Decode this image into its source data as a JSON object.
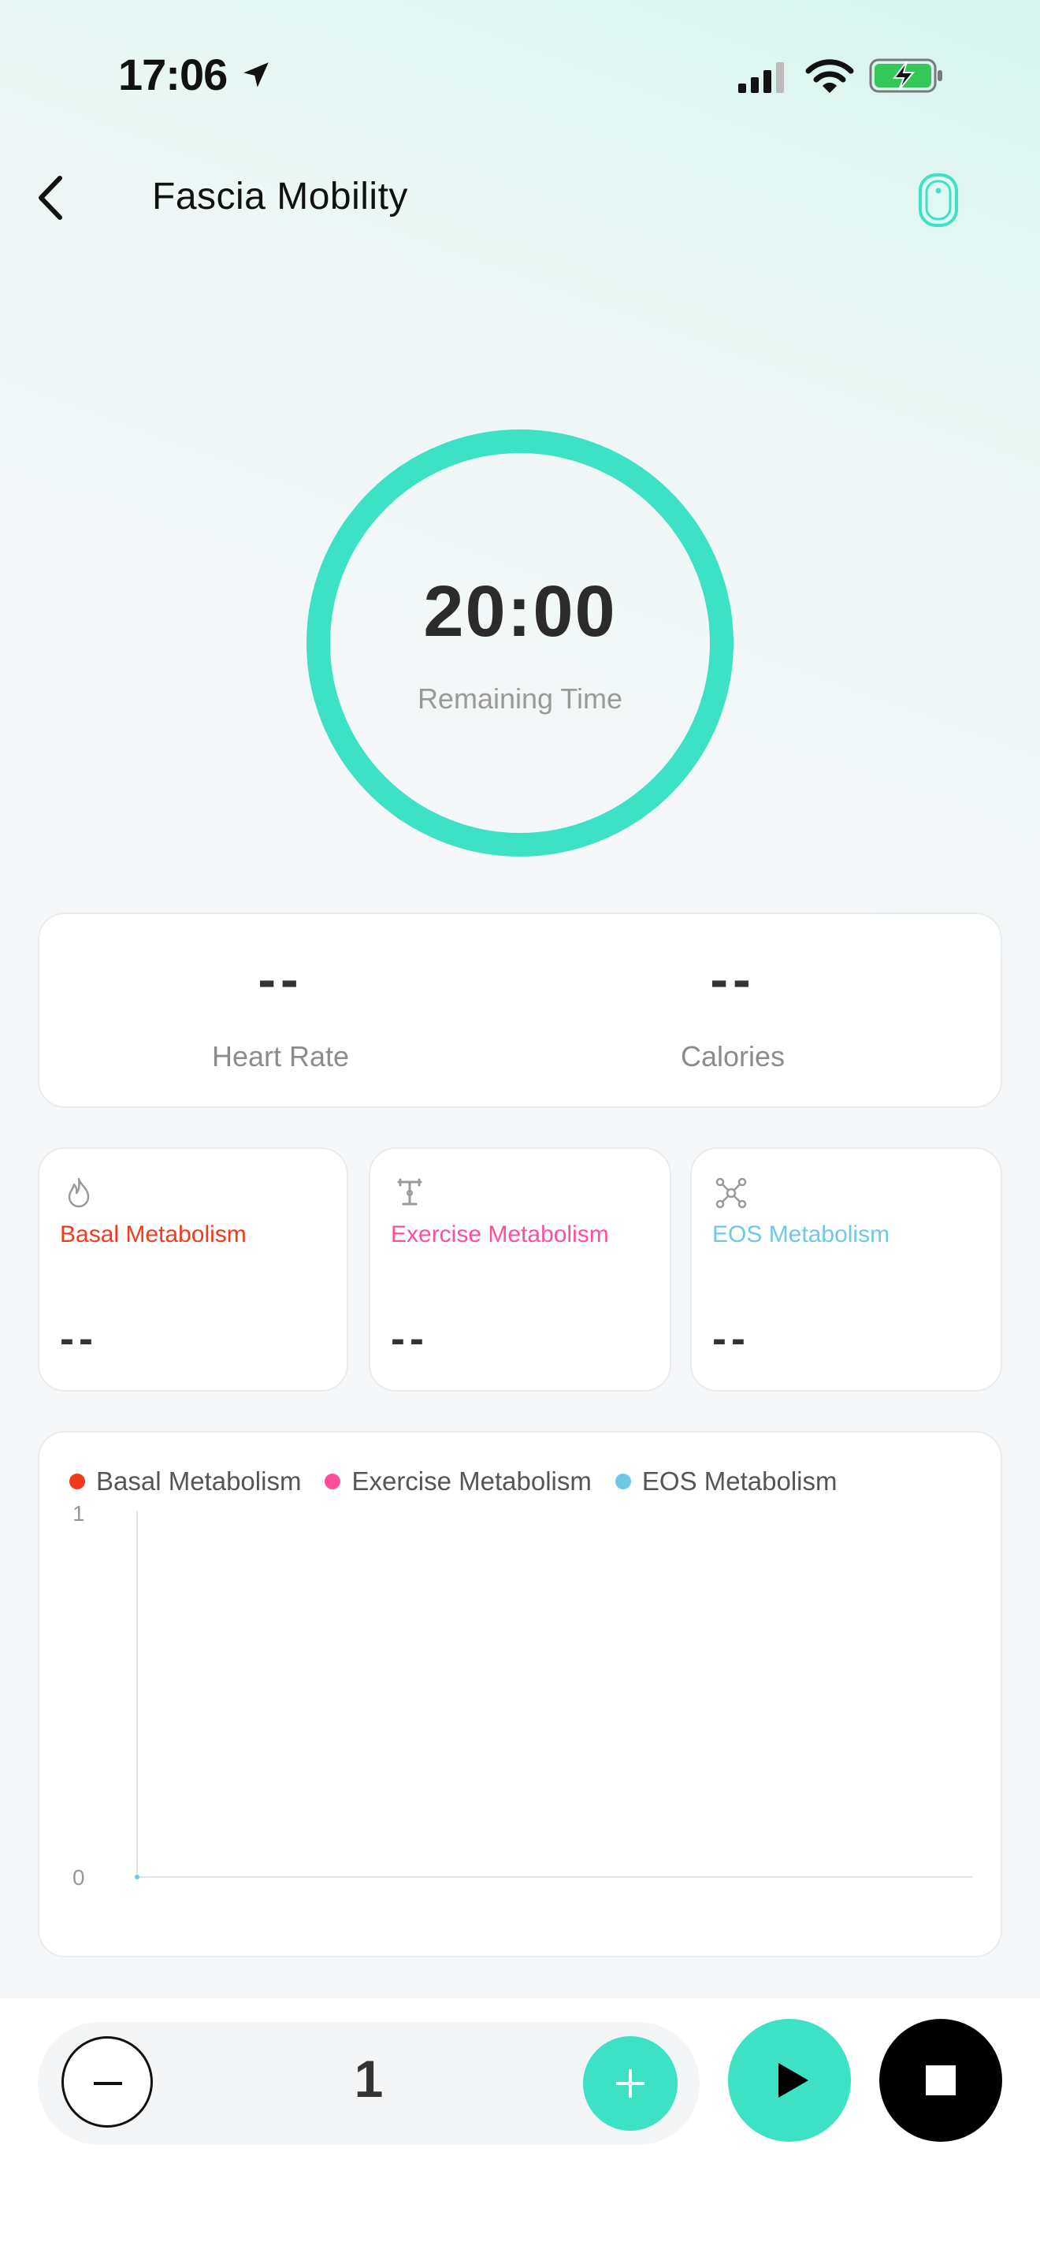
{
  "status_bar": {
    "time": "17:06"
  },
  "header": {
    "title": "Fascia Mobility"
  },
  "timer": {
    "value": "20:00",
    "label": "Remaining Time"
  },
  "stats": {
    "heart_rate": {
      "value": "--",
      "label": "Heart Rate"
    },
    "calories": {
      "value": "--",
      "label": "Calories"
    }
  },
  "metabolism": [
    {
      "label": "Basal Metabolism",
      "value": "--",
      "color": "#f23a1d",
      "icon": "flame-icon"
    },
    {
      "label": "Exercise Metabolism",
      "value": "--",
      "color": "#ff4f9a",
      "icon": "dumbbell-icon"
    },
    {
      "label": "EOS Metabolism",
      "value": "--",
      "color": "#6fc8e6",
      "icon": "molecule-icon"
    }
  ],
  "chart_data": {
    "type": "line",
    "series": [
      {
        "name": "Basal Metabolism",
        "color": "#f23a1d",
        "values": []
      },
      {
        "name": "Exercise Metabolism",
        "color": "#ff4f9a",
        "values": []
      },
      {
        "name": "EOS Metabolism",
        "color": "#6fc8e6",
        "values": []
      }
    ],
    "y_ticks": [
      "1",
      "0"
    ],
    "ylim": [
      0,
      1
    ],
    "legend": "top-left",
    "grid": false
  },
  "controls": {
    "stepper_value": "1"
  },
  "colors": {
    "accent": "#3de2c5",
    "ring": "#3de2c5"
  }
}
